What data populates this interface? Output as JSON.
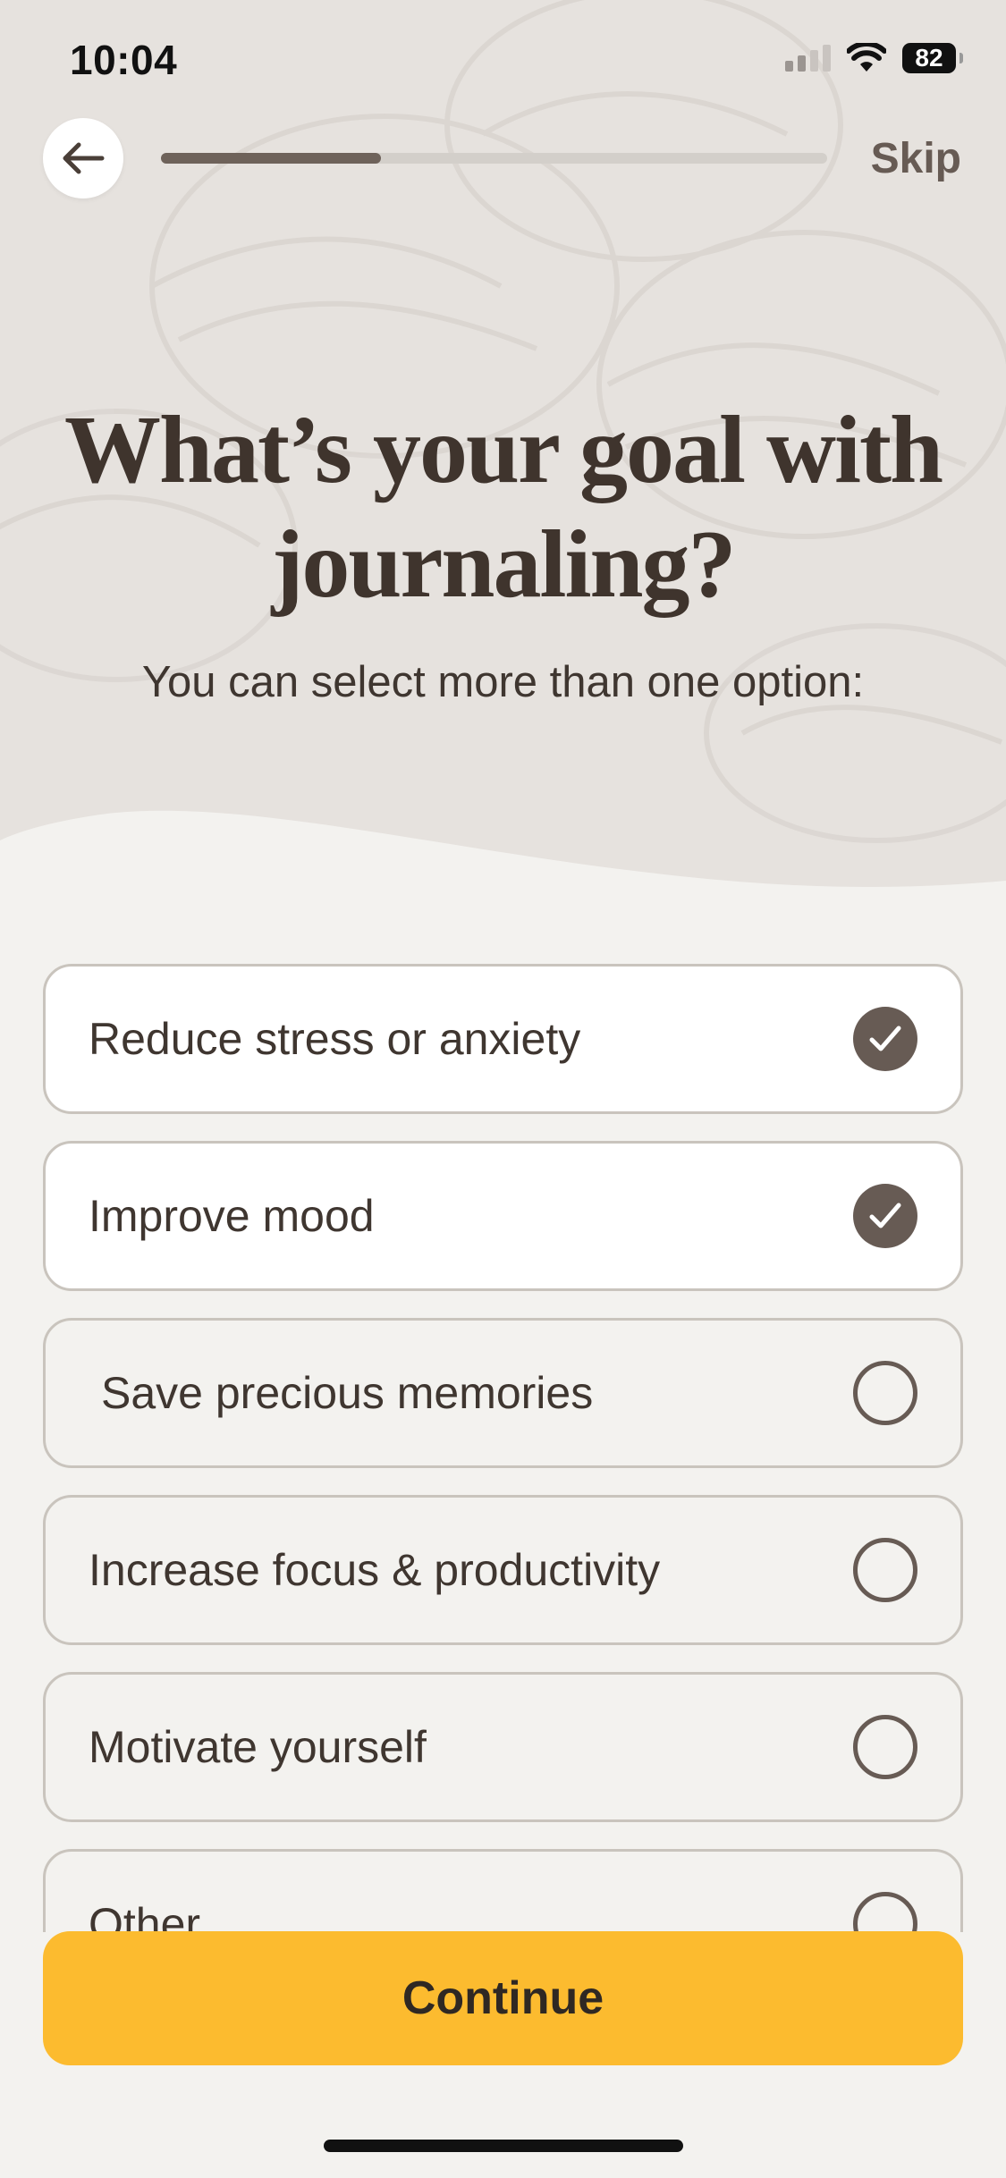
{
  "status_bar": {
    "time": "10:04",
    "battery": "82"
  },
  "nav": {
    "back_icon": "arrow-left-icon",
    "skip_label": "Skip",
    "progress": 0.33
  },
  "header": {
    "title": "What’s your goal with journaling?",
    "subtitle": "You can select more than one option:"
  },
  "options": [
    {
      "label": "Reduce stress or anxiety",
      "selected": true
    },
    {
      "label": "Improve mood",
      "selected": true
    },
    {
      "label": "Save precious memories",
      "selected": false
    },
    {
      "label": "Increase focus & productivity",
      "selected": false
    },
    {
      "label": "Motivate yourself",
      "selected": false
    },
    {
      "label": "Other",
      "selected": false
    }
  ],
  "footer": {
    "continue_label": "Continue"
  },
  "colors": {
    "background": "#F3F2EF",
    "header_background": "#E7E4E0",
    "accent": "#FCBB2F",
    "check": "#675B54",
    "text": "#3F3630"
  }
}
